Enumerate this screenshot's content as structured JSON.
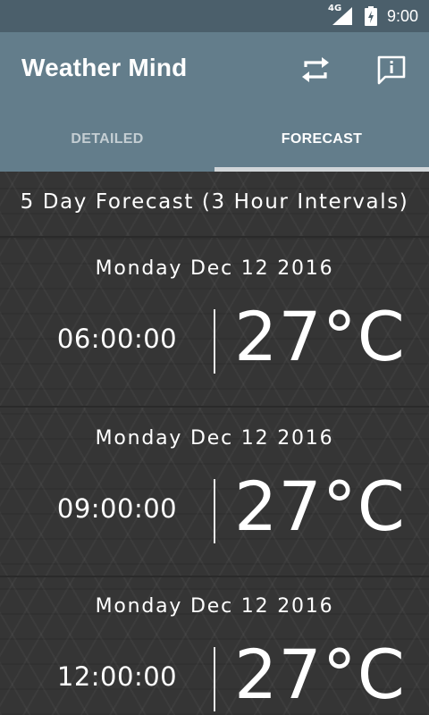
{
  "status_bar": {
    "network": "4G",
    "time": "9:00"
  },
  "app_bar": {
    "title": "Weather Mind",
    "actions": [
      {
        "icon": "refresh-icon"
      },
      {
        "icon": "info-icon"
      }
    ]
  },
  "tabs": [
    {
      "label": "DETAILED",
      "selected": false
    },
    {
      "label": "FORECAST",
      "selected": true
    }
  ],
  "forecast": {
    "header": "5 Day Forecast (3 Hour Intervals)",
    "items": [
      {
        "date": "Monday Dec 12 2016",
        "time": "06:00:00",
        "temp": "27°C"
      },
      {
        "date": "Monday Dec 12 2016",
        "time": "09:00:00",
        "temp": "27°C"
      },
      {
        "date": "Monday Dec 12 2016",
        "time": "12:00:00",
        "temp": "27°C"
      }
    ]
  },
  "colors": {
    "status_bar": "#4b5f6b",
    "app_bar": "#637d8b",
    "background": "#353535",
    "tab_indicator": "#d0d5d8",
    "text": "#ffffff"
  }
}
